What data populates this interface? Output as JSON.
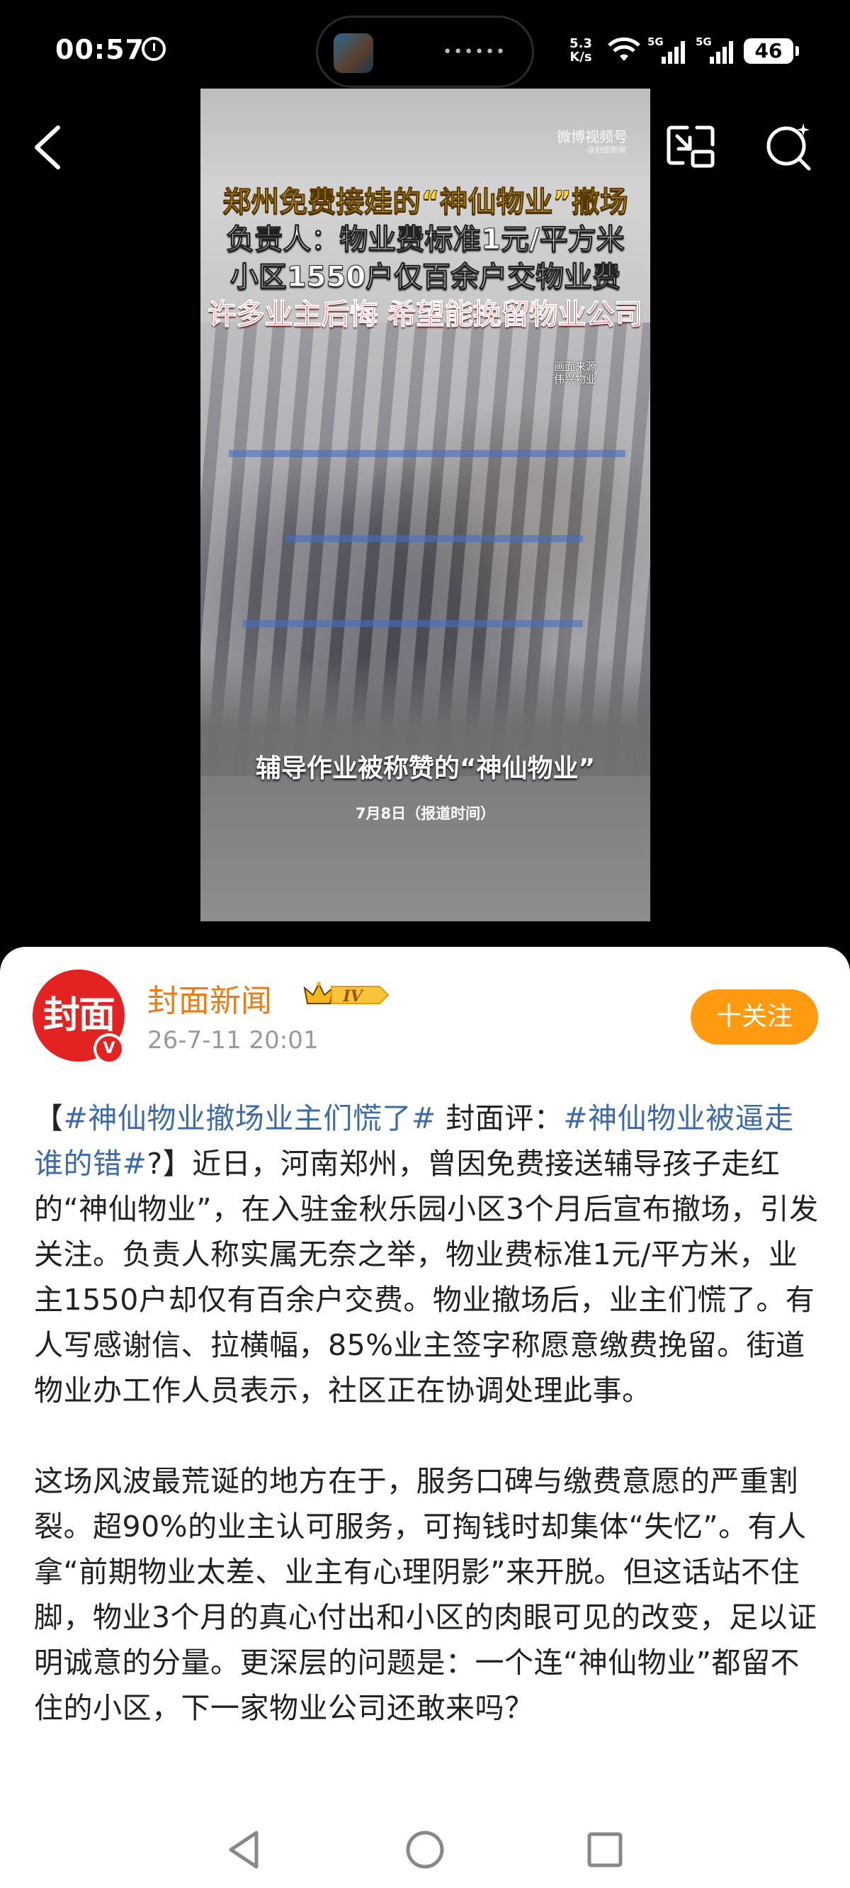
{
  "status_bar": {
    "time": "00:57",
    "net_speed_value": "5.3",
    "net_speed_unit": "K/s",
    "signal1_label": "5G",
    "signal2_label": "5G",
    "battery": "46"
  },
  "video": {
    "watermark": "微博视频号",
    "watermark_sub": "@封面新闻",
    "headline1": "郑州免费接娃的“神仙物业”撤场",
    "headline2": "负责人：物业费标准1元/平方米",
    "headline3": "小区1550户仅百余户交物业费",
    "headline4": "许多业主后悔 希望能挽留物业公司",
    "source_line1": "画面来源",
    "source_line2": "伟兴物业",
    "caption": "辅导作业被称赞的“神仙物业”",
    "date_note": "7月8日（报道时间）"
  },
  "post": {
    "avatar_text": "封面",
    "author": "封面新闻",
    "level_badge": "IV",
    "time": "26-7-11 20:01",
    "follow_label": "十关注",
    "para1": {
      "bracket_open": "【",
      "tag1": "#神仙物业撤场业主们慌了#",
      "mid": " 封面评：",
      "tag2": "#神仙物业被逼走谁的错#",
      "after": "?】近日，河南郑州，曾因免费接送辅导孩子走红的“神仙物业”，在入驻金秋乐园小区3个月后宣布撤场，引发关注。负责人称实属无奈之举，物业费标准1元/平方米，业主1550户却仅有百余户交费。物业撤场后，业主们慌了。有人写感谢信、拉横幅，85%业主签字称愿意缴费挽留。街道物业办工作人员表示，社区正在协调处理此事。"
    },
    "para2": "这场风波最荒诞的地方在于，服务口碑与缴费意愿的严重割裂。超90%的业主认可服务，可掏钱时却集体“失忆”。有人拿“前期物业太差、业主有心理阴影”来开脱。但这话站不住脚，物业3个月的真心付出和小区的肉眼可见的改变，足以证明诚意的分量。更深层的问题是：一个连“神仙物业”都留不住的小区，下一家物业公司还敢来吗？"
  },
  "colors": {
    "brand_red": "#e32222",
    "author_orange": "#f07a12",
    "follow_orange": "#ff9a11",
    "tag_blue": "#3d6ba8"
  }
}
